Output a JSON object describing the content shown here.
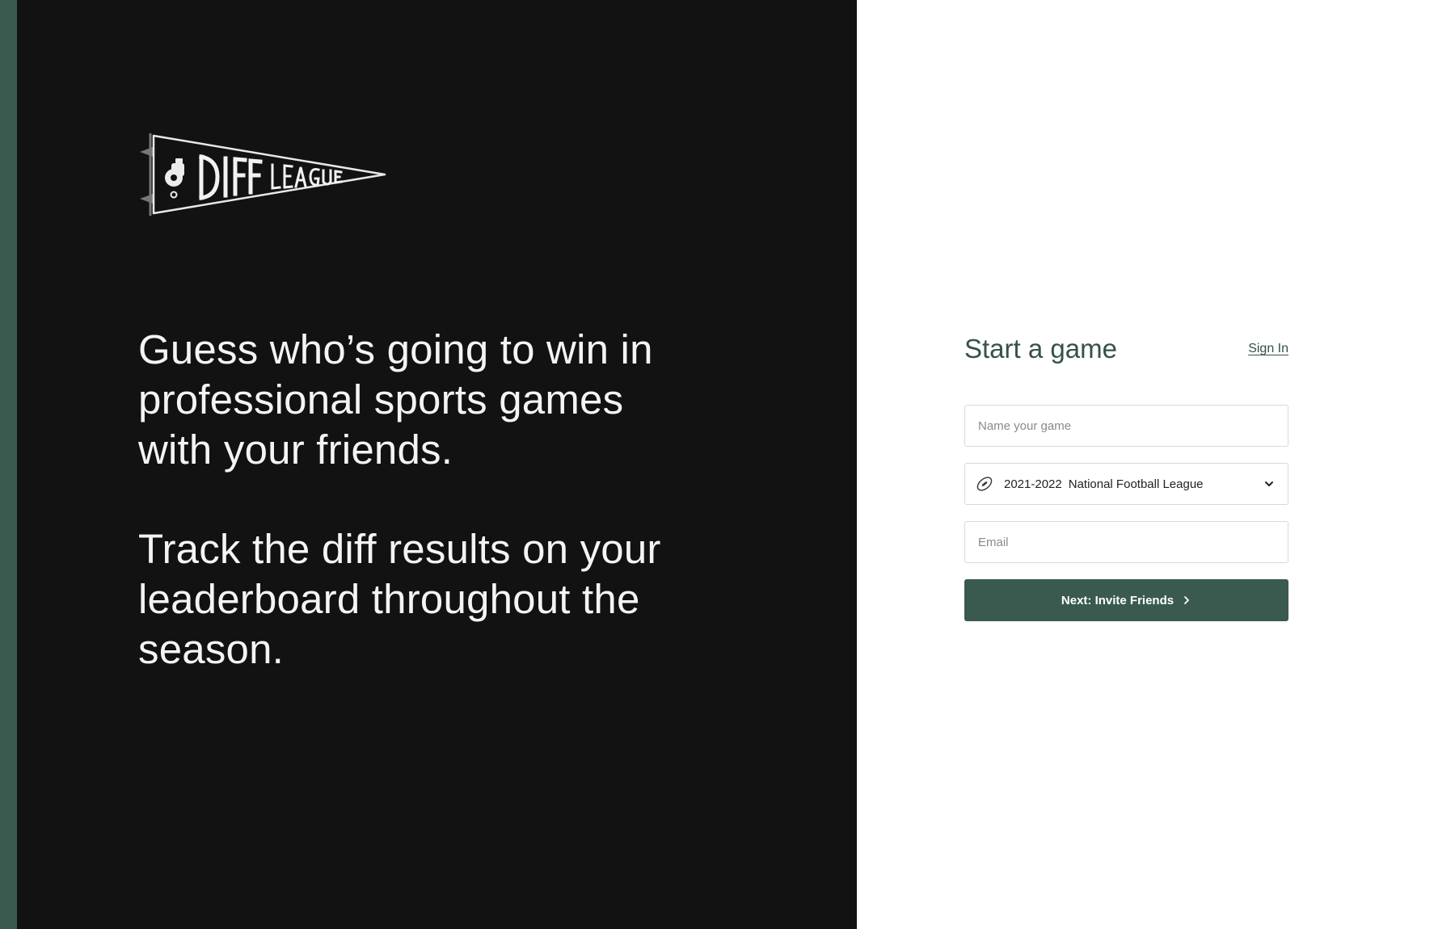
{
  "brand": {
    "logo_text": "DIFF LEAGUE",
    "logo_icon": "whistle-icon"
  },
  "hero": {
    "tagline_1": "Guess who’s going to win in professional sports games with your friends.",
    "tagline_2": "Track the diff results on your leaderboard throughout the season."
  },
  "form": {
    "title": "Start a game",
    "sign_in_label": "Sign In",
    "game_name": {
      "placeholder": "Name your game",
      "value": ""
    },
    "league_select": {
      "icon": "football-icon",
      "season": "2021-2022",
      "league": "National Football League"
    },
    "email": {
      "placeholder": "Email",
      "value": ""
    },
    "next_button_label": "Next: Invite Friends"
  },
  "colors": {
    "accent": "#3a5a4f",
    "dark_panel": "#121212",
    "heading_green": "#355247"
  }
}
